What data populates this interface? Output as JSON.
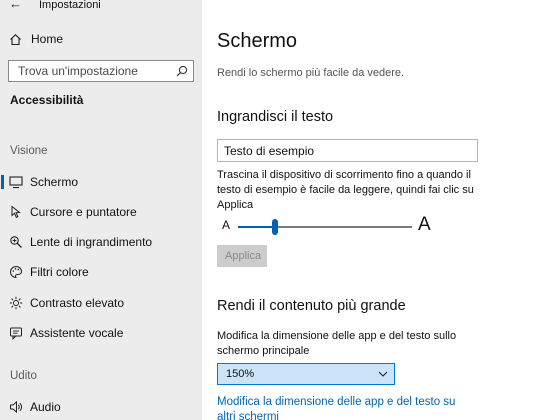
{
  "window": {
    "title": "Impostazioni"
  },
  "sidebar": {
    "home_label": "Home",
    "search": {
      "placeholder": "Trova un'impostazione"
    },
    "section_title": "Accessibilità",
    "group_vision": "Visione",
    "group_hearing": "Udito",
    "items": [
      {
        "label": "Schermo",
        "icon": "monitor-icon",
        "selected": true
      },
      {
        "label": "Cursore e puntatore",
        "icon": "cursor-icon",
        "selected": false
      },
      {
        "label": "Lente di ingrandimento",
        "icon": "magnifier-icon",
        "selected": false
      },
      {
        "label": "Filtri colore",
        "icon": "color-filter-icon",
        "selected": false
      },
      {
        "label": "Contrasto elevato",
        "icon": "contrast-icon",
        "selected": false
      },
      {
        "label": "Assistente vocale",
        "icon": "narrator-icon",
        "selected": false
      },
      {
        "label": "Audio",
        "icon": "speaker-icon",
        "selected": false
      }
    ]
  },
  "main": {
    "title": "Schermo",
    "description": "Rendi lo schermo più facile da vedere.",
    "text_size": {
      "heading": "Ingrandisci il testo",
      "sample_value": "Testo di esempio",
      "instructions": "Trascina il dispositivo di scorrimento fino a quando il testo di esempio è facile da leggere, quindi fai clic su Applica",
      "slider_min_label": "A",
      "slider_max_label": "A",
      "slider_value": 0.21,
      "apply_label": "Applica"
    },
    "scale": {
      "heading": "Rendi il contenuto più grande",
      "instructions": "Modifica la dimensione delle app e del testo sullo schermo principale",
      "selected_value": "150%",
      "link_text": "Modifica la dimensione delle app e del testo su altri schermi"
    }
  },
  "colors": {
    "accent": "#0063b1",
    "sidebar_bg": "#ececec",
    "link": "#0066b4"
  }
}
